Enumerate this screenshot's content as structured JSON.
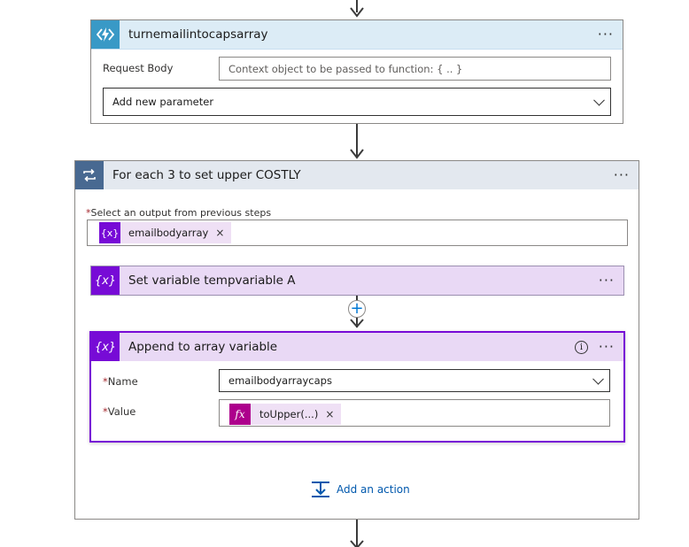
{
  "func_card": {
    "title": "turnemailintocapsarray",
    "request_body_label": "Request Body",
    "request_body_placeholder": "Context object to be passed to function: { .. }",
    "add_param_label": "Add new parameter",
    "menu_label": "···"
  },
  "foreach_card": {
    "title": "For each 3 to set upper COSTLY",
    "select_label": "Select an output from previous steps",
    "required_mark": "*",
    "token_text": "emailbodyarray",
    "token_remove": "×",
    "menu_label": "···"
  },
  "setvar_card": {
    "title": "Set variable tempvariable A",
    "menu_label": "···"
  },
  "append_card": {
    "title": "Append to array variable",
    "info_label": "i",
    "menu_label": "···",
    "name_label": "Name",
    "name_value": "emailbodyarraycaps",
    "value_label": "Value",
    "value_token": "toUpper(...)",
    "value_token_remove": "×",
    "required_mark": "*"
  },
  "add_action": {
    "label": "Add an action"
  },
  "insert_step": {
    "label": "+"
  },
  "colors": {
    "function_accent": "#3999c6",
    "variable_accent": "#770bd6",
    "expression_accent": "#ad008c",
    "foreach_accent": "#486991",
    "link": "#0058ad"
  }
}
